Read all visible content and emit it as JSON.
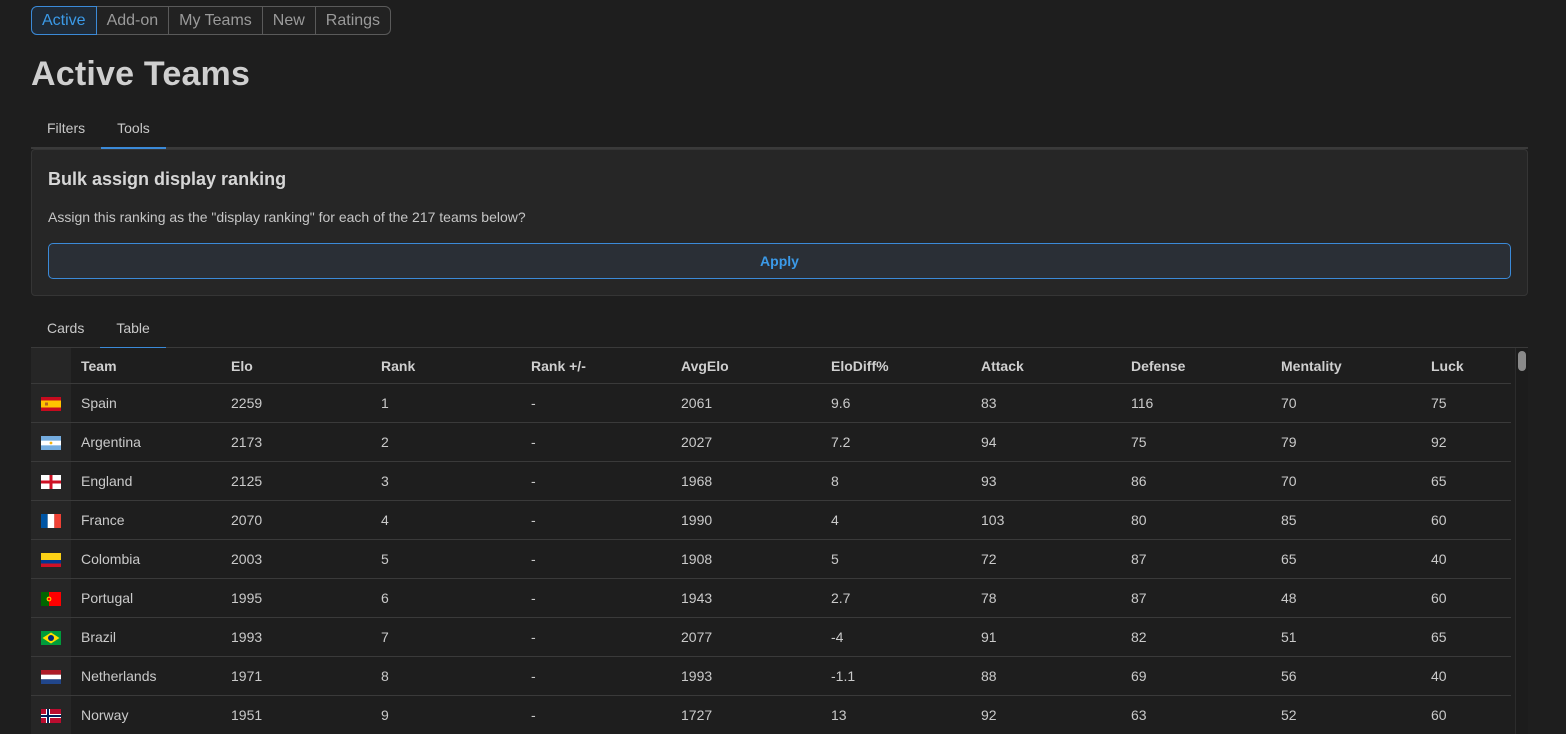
{
  "nav": {
    "buttons": [
      {
        "label": "Active",
        "active": true
      },
      {
        "label": "Add-on",
        "active": false
      },
      {
        "label": "My Teams",
        "active": false
      },
      {
        "label": "New",
        "active": false
      },
      {
        "label": "Ratings",
        "active": false
      }
    ]
  },
  "page_title": "Active Teams",
  "top_tabs": [
    {
      "label": "Filters",
      "active": false
    },
    {
      "label": "Tools",
      "active": true
    }
  ],
  "tools": {
    "title": "Bulk assign display ranking",
    "description": "Assign this ranking as the \"display ranking\" for each of the 217 teams below?",
    "apply_label": "Apply"
  },
  "view_tabs": [
    {
      "label": "Cards",
      "active": false
    },
    {
      "label": "Table",
      "active": true
    }
  ],
  "table": {
    "columns": [
      "Team",
      "Elo",
      "Rank",
      "Rank +/-",
      "AvgElo",
      "EloDiff%",
      "Attack",
      "Defense",
      "Mentality",
      "Luck"
    ],
    "rows": [
      {
        "flag": "flag-spain-icon",
        "cells": [
          "Spain",
          "2259",
          "1",
          "-",
          "2061",
          "9.6",
          "83",
          "116",
          "70",
          "75"
        ]
      },
      {
        "flag": "flag-argentina-icon",
        "cells": [
          "Argentina",
          "2173",
          "2",
          "-",
          "2027",
          "7.2",
          "94",
          "75",
          "79",
          "92"
        ]
      },
      {
        "flag": "flag-england-icon",
        "cells": [
          "England",
          "2125",
          "3",
          "-",
          "1968",
          "8",
          "93",
          "86",
          "70",
          "65"
        ]
      },
      {
        "flag": "flag-france-icon",
        "cells": [
          "France",
          "2070",
          "4",
          "-",
          "1990",
          "4",
          "103",
          "80",
          "85",
          "60"
        ]
      },
      {
        "flag": "flag-colombia-icon",
        "cells": [
          "Colombia",
          "2003",
          "5",
          "-",
          "1908",
          "5",
          "72",
          "87",
          "65",
          "40"
        ]
      },
      {
        "flag": "flag-portugal-icon",
        "cells": [
          "Portugal",
          "1995",
          "6",
          "-",
          "1943",
          "2.7",
          "78",
          "87",
          "48",
          "60"
        ]
      },
      {
        "flag": "flag-brazil-icon",
        "cells": [
          "Brazil",
          "1993",
          "7",
          "-",
          "2077",
          "-4",
          "91",
          "82",
          "51",
          "65"
        ]
      },
      {
        "flag": "flag-netherlands-icon",
        "cells": [
          "Netherlands",
          "1971",
          "8",
          "-",
          "1993",
          "-1.1",
          "88",
          "69",
          "56",
          "40"
        ]
      },
      {
        "flag": "flag-norway-icon",
        "cells": [
          "Norway",
          "1951",
          "9",
          "-",
          "1727",
          "13",
          "92",
          "63",
          "52",
          "60"
        ]
      }
    ]
  },
  "colors": {
    "accent": "#3b9ae8",
    "background": "#1e1e1e"
  }
}
